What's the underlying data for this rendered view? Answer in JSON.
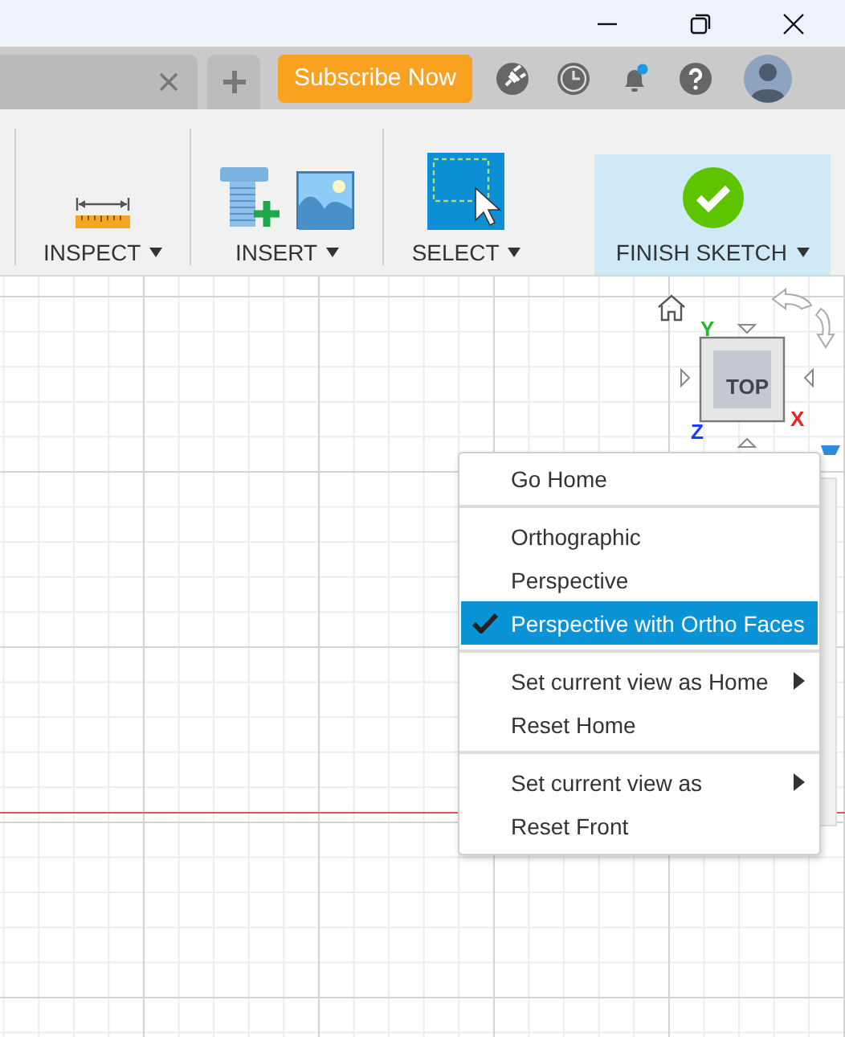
{
  "tab_bar": {
    "subscribe_button": "Subscribe Now",
    "notification_unread": true
  },
  "toolbar": {
    "groups": [
      {
        "label": "INSPECT",
        "kind": "inspect",
        "highlighted": false
      },
      {
        "label": "INSERT",
        "kind": "insert",
        "highlighted": false
      },
      {
        "label": "SELECT",
        "kind": "select",
        "highlighted": false
      },
      {
        "label": "FINISH SKETCH",
        "kind": "finish",
        "highlighted": true
      }
    ]
  },
  "viewcube": {
    "face": "TOP",
    "axes": [
      {
        "label": "Y",
        "color": "#22bb22"
      },
      {
        "label": "X",
        "color": "#ee2222"
      },
      {
        "label": "Z",
        "color": "#1a3cff"
      }
    ]
  },
  "context_menu": {
    "groups": [
      [
        {
          "label": "Go Home",
          "checked": false,
          "submenu": false
        }
      ],
      [
        {
          "label": "Orthographic",
          "checked": false,
          "submenu": false
        },
        {
          "label": "Perspective",
          "checked": false,
          "submenu": false
        },
        {
          "label": "Perspective with Ortho Faces",
          "checked": true,
          "submenu": false
        }
      ],
      [
        {
          "label": "Set current view as Home",
          "checked": false,
          "submenu": true
        },
        {
          "label": "Reset Home",
          "checked": false,
          "submenu": false
        }
      ],
      [
        {
          "label": "Set current view as",
          "checked": false,
          "submenu": true
        },
        {
          "label": "Reset Front",
          "checked": false,
          "submenu": false
        }
      ]
    ]
  }
}
